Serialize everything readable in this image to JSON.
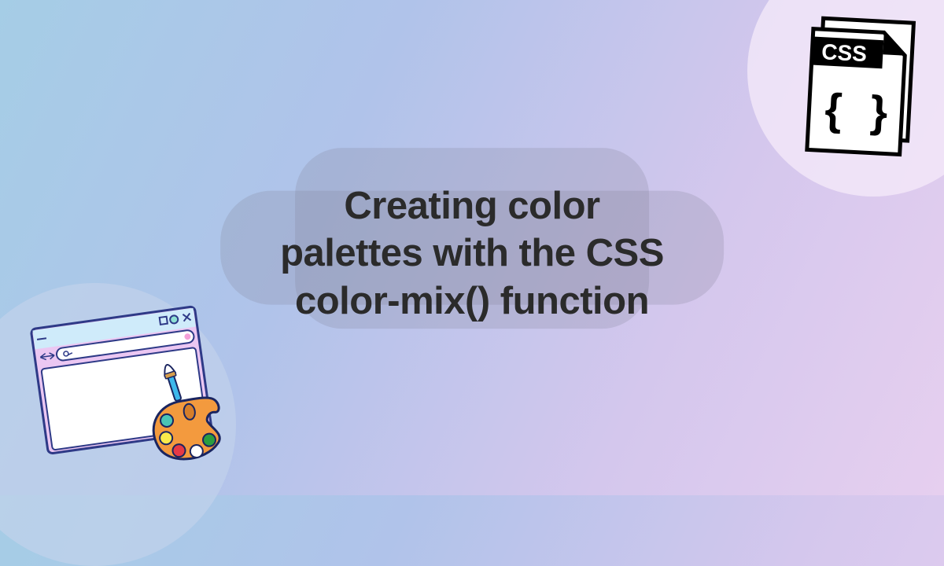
{
  "heading": {
    "line1": "Creating color",
    "line2": "palettes with the CSS",
    "line3": "color-mix() function"
  },
  "icons": {
    "css_file_label": "CSS",
    "braces": "{ }"
  }
}
